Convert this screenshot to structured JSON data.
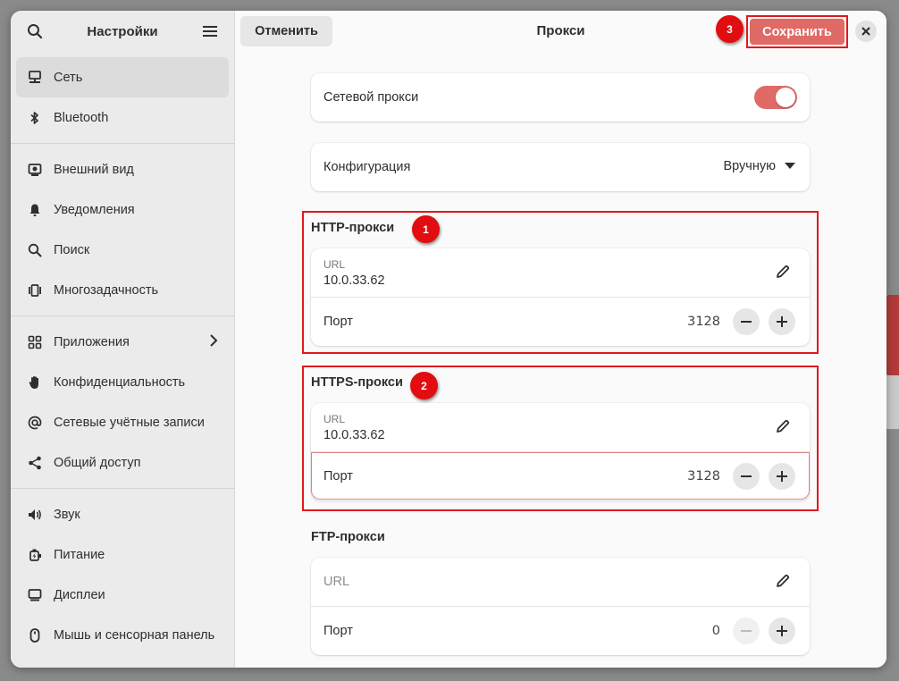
{
  "sidebar": {
    "title": "Настройки",
    "items": [
      {
        "label": "Сеть",
        "icon": "network-icon",
        "active": true
      },
      {
        "label": "Bluetooth",
        "icon": "bluetooth-icon"
      },
      {
        "label": "Внешний вид",
        "icon": "appearance-icon"
      },
      {
        "label": "Уведомления",
        "icon": "bell-icon"
      },
      {
        "label": "Поиск",
        "icon": "search-icon"
      },
      {
        "label": "Многозадачность",
        "icon": "multitasking-icon"
      },
      {
        "label": "Приложения",
        "icon": "apps-grid-icon"
      },
      {
        "label": "Конфиденциальность",
        "icon": "hand-icon"
      },
      {
        "label": "Сетевые учётные записи",
        "icon": "at-sign-icon"
      },
      {
        "label": "Общий доступ",
        "icon": "share-icon"
      },
      {
        "label": "Звук",
        "icon": "speaker-icon"
      },
      {
        "label": "Питание",
        "icon": "power-plug-icon"
      },
      {
        "label": "Дисплеи",
        "icon": "display-icon"
      },
      {
        "label": "Мышь и сенсорная панель",
        "icon": "mouse-icon"
      }
    ]
  },
  "header": {
    "cancel_label": "Отменить",
    "title": "Прокси",
    "save_label": "Сохранить"
  },
  "badges": {
    "one": "1",
    "two": "2",
    "three": "3"
  },
  "proxy": {
    "network_proxy_label": "Сетевой прокси",
    "network_proxy_enabled": true,
    "config_label": "Конфигурация",
    "config_value": "Вручную",
    "http": {
      "title": "HTTP-прокси",
      "url_label": "URL",
      "url_value": "10.0.33.62",
      "port_label": "Порт",
      "port_value": "3128"
    },
    "https": {
      "title": "HTTPS-прокси",
      "url_label": "URL",
      "url_value": "10.0.33.62",
      "port_label": "Порт",
      "port_value": "3128"
    },
    "ftp": {
      "title": "FTP-прокси",
      "url_placeholder": "URL",
      "port_label": "Порт",
      "port_value": "0"
    }
  },
  "colors": {
    "accent": "#e06a66",
    "annotation": "#e0191d"
  }
}
